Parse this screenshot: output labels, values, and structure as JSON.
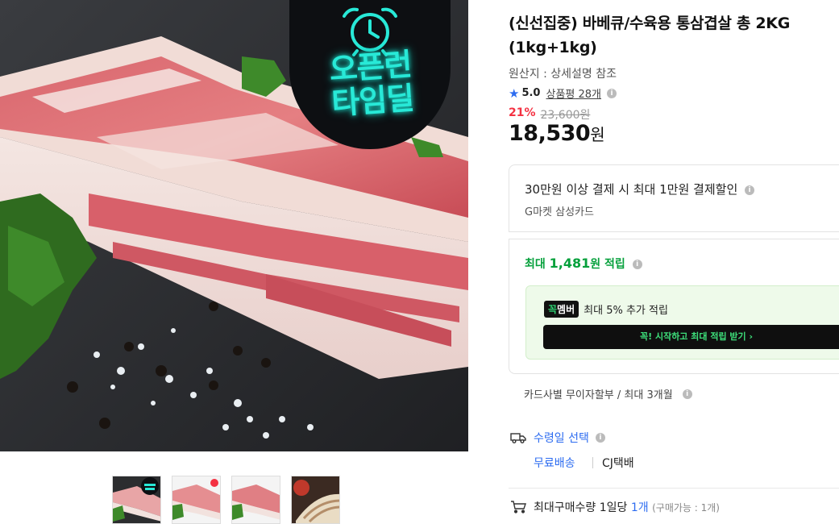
{
  "product": {
    "title": "(신선집중) 바베큐/수육용 통삼겹살 총 2KG (1kg+1kg)",
    "origin": "원산지 : 상세설명 참조",
    "rating": "5.0",
    "review_label": "상품평",
    "review_count": "28개",
    "discount": "21%",
    "original_price": "23,600원",
    "price": "18,530",
    "price_unit": "원"
  },
  "badge": {
    "line1": "오픈런",
    "line2": "타임딜"
  },
  "card_promo": {
    "main": "30만원 이상 결제 시 최대 1만원 결제할인",
    "sub": "G마켓 삼성카드"
  },
  "reward": {
    "prefix": "최대 ",
    "amount": "1,481",
    "suffix": "원 적립",
    "member_tag_1": "꼭",
    "member_tag_2": "멤버",
    "member_text": "최대 5% 추가 적립",
    "cta": "꼭! 시작하고 최대 적립 받기 ›"
  },
  "installment": "카드사별 무이자할부 / 최대 3개월",
  "delivery": {
    "label": "수령일 선택",
    "free": "무료배송",
    "carrier": "CJ택배"
  },
  "max_buy": {
    "label": "최대구매수량 1일당",
    "count": "1개",
    "note": "(구매가능 : 1개)"
  },
  "icons": {
    "info": "info-icon",
    "star": "star-icon",
    "truck": "truck-icon",
    "cart": "cart-icon",
    "alarm": "alarm-clock-icon"
  },
  "colors": {
    "accent_blue": "#2d6cf0",
    "discount_red": "#f43142",
    "reward_green": "#05a03b",
    "badge_cyan": "#28e9d7"
  }
}
